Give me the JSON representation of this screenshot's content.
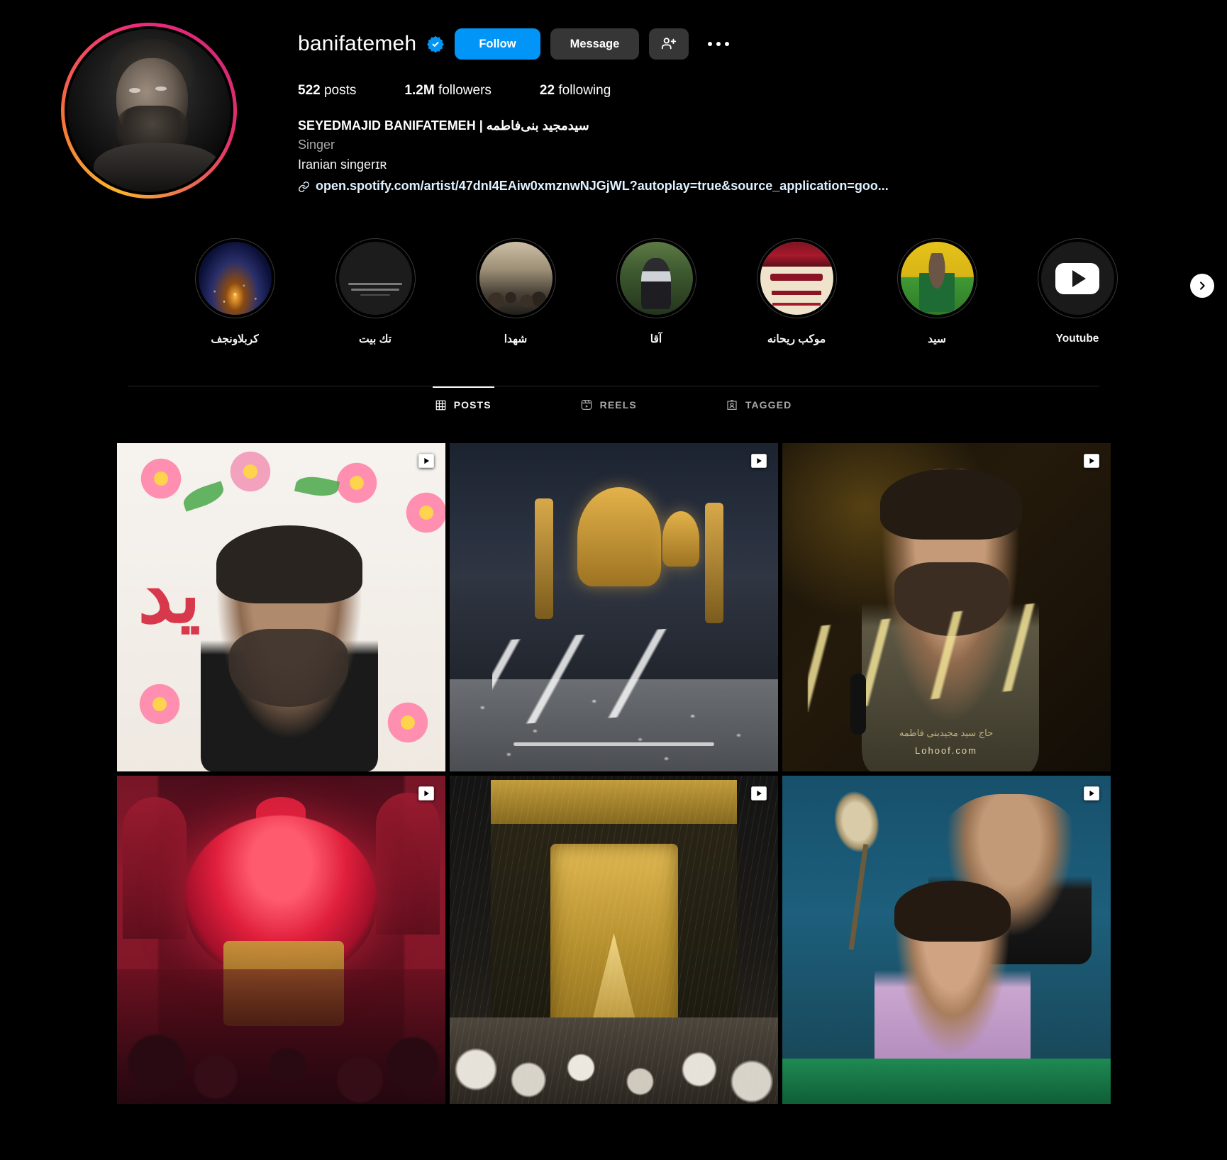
{
  "profile": {
    "username": "banifatemeh",
    "verified_icon": "verified-badge-icon",
    "avatar_alt": "profile-photo"
  },
  "actions": {
    "follow_label": "Follow",
    "message_label": "Message",
    "add_person_icon": "add-person-icon",
    "more_options_icon": "more-options-icon",
    "accent_color": "#0095f6",
    "secondary_button_color": "#363636"
  },
  "stats": [
    {
      "value": "522",
      "label": "posts"
    },
    {
      "value": "1.2M",
      "label": "followers"
    },
    {
      "value": "22",
      "label": "following"
    }
  ],
  "bio": {
    "full_name": "SEYEDMAJID BANIFATEMEH | سیدمجید بنی‌فاطمه",
    "category": "Singer",
    "description": "Iranian singerɪʀ",
    "link_icon": "link-chain-icon",
    "link": "open.spotify.com/artist/47dnI4EAiw0xmznwNJGjWL?autoplay=true&source_application=goo..."
  },
  "highlights": {
    "next_icon": "chevron-right-icon",
    "items": [
      {
        "label": "کربلاونجف",
        "art": "h-karbala"
      },
      {
        "label": "تك بيت",
        "art": "h-takbeit"
      },
      {
        "label": "شهدا",
        "art": "h-shohada"
      },
      {
        "label": "آقا",
        "art": "h-agha"
      },
      {
        "label": "موکب ریحانه",
        "art": "h-mowkeb"
      },
      {
        "label": "سید",
        "art": "h-seyed"
      },
      {
        "label": "Youtube",
        "art": "h-youtube"
      }
    ]
  },
  "tabs": [
    {
      "label": "POSTS",
      "icon": "grid-icon",
      "active": true
    },
    {
      "label": "REELS",
      "icon": "reels-icon",
      "active": false
    },
    {
      "label": "TAGGED",
      "icon": "tagged-person-icon",
      "active": false
    }
  ],
  "grid": {
    "badge_icon": "reel-clip-icon",
    "posts": [
      {
        "art": "c1",
        "is_reel": true,
        "alt": "man speaking in front of floral banner"
      },
      {
        "art": "c2",
        "is_reel": true,
        "alt": "golden shrine with pigeons and persian calligraphy"
      },
      {
        "art": "c3",
        "is_reel": true,
        "alt": "singer portrait with golden calligraphy",
        "caption_line1": "حاج سید مجیدبنی فاطمه",
        "caption_line2": "Lohoof.com"
      },
      {
        "art": "c4",
        "is_reel": true,
        "alt": "red chandelier inside shrine hall"
      },
      {
        "art": "c5",
        "is_reel": true,
        "alt": "golden door of the kaaba with crowd"
      },
      {
        "art": "c6",
        "is_reel": true,
        "alt": "boy singing holding a feathered standard"
      }
    ]
  }
}
